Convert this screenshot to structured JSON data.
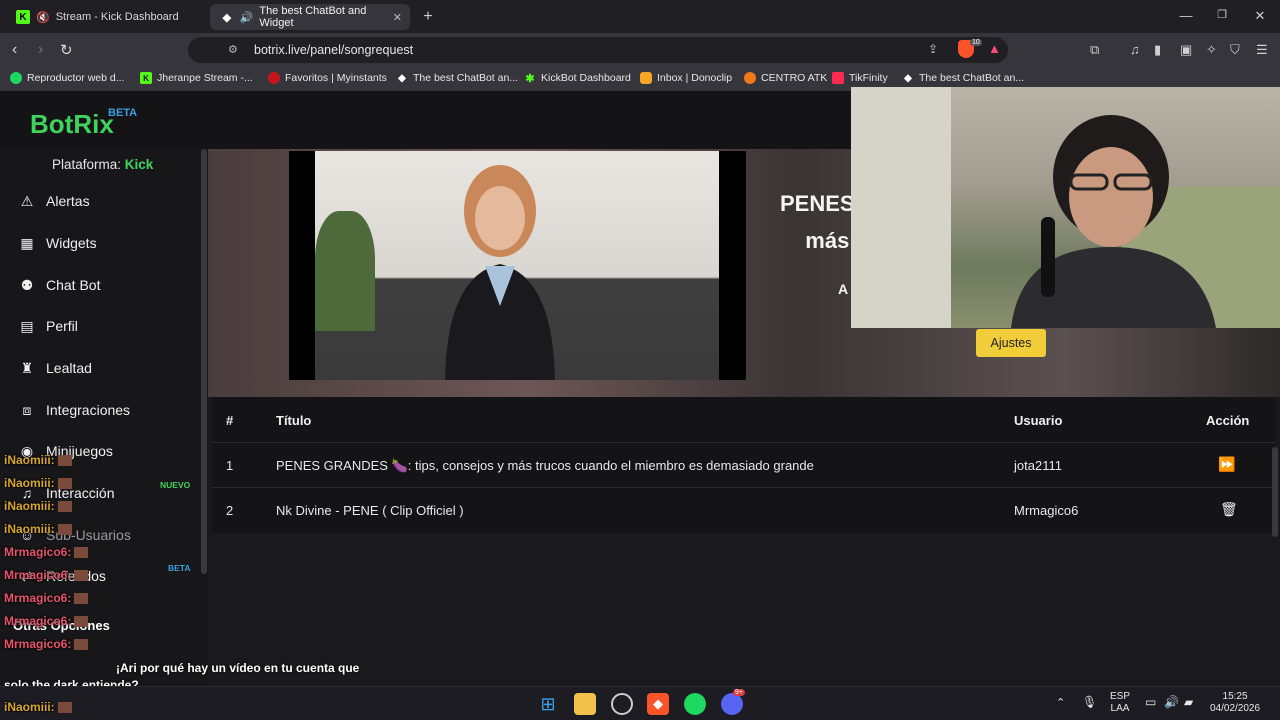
{
  "browser": {
    "tabs": [
      {
        "title": "Stream - Kick Dashboard",
        "active": false
      },
      {
        "title": "The best ChatBot and Widget",
        "active": true
      }
    ],
    "url": "botrix.live/panel/songrequest",
    "bookmarks": [
      "Reproductor web d...",
      "Jheranpe Stream -...",
      "Favoritos | Myinstants",
      "The best ChatBot an...",
      "KickBot Dashboard",
      "Inbox | Donoclip",
      "CENTRO ATK",
      "TikFinity",
      "The best ChatBot an..."
    ],
    "shield_count": "10"
  },
  "app": {
    "logo": "BotRix",
    "logo_badge": "BETA",
    "platform_label": "Plataforma:",
    "platform_value": "Kick",
    "nav": [
      {
        "label": "Alertas",
        "icon": "warning-icon"
      },
      {
        "label": "Widgets",
        "icon": "grid-icon"
      },
      {
        "label": "Chat Bot",
        "icon": "robot-icon"
      },
      {
        "label": "Perfil",
        "icon": "id-card-icon"
      },
      {
        "label": "Lealtad",
        "icon": "trophy-icon"
      },
      {
        "label": "Integraciones",
        "icon": "plug-icon"
      },
      {
        "label": "Minijuegos",
        "icon": "gamepad-icon"
      },
      {
        "label": "Interacción",
        "icon": "music-icon"
      },
      {
        "label": "Sub-Usuarios",
        "icon": "users-icon"
      },
      {
        "label": "Referidos",
        "icon": "share-icon"
      }
    ],
    "badge_nuevo": "NUEVO",
    "badge_beta": "BETA",
    "section_other": "Otras Opciones",
    "hero_title_line1": "PENES",
    "hero_title_line2": "más",
    "hero_title_partial": "A",
    "settings_button": "Ajustes",
    "table": {
      "headers": [
        "#",
        "Título",
        "Usuario",
        "Acción"
      ],
      "rows": [
        {
          "n": "1",
          "title": "PENES GRANDES 🍆: tips, consejos y más trucos cuando el miembro es demasiado grande",
          "user": "jota2111",
          "action": "skip"
        },
        {
          "n": "2",
          "title": "Nk Divine - PENE ( Clip Officiel )",
          "user": "Mrmagico6",
          "action": "delete"
        }
      ]
    }
  },
  "chat": {
    "lines": [
      {
        "user": "iNaomiii:",
        "color": "n"
      },
      {
        "user": "iNaomiii:",
        "color": "n"
      },
      {
        "user": "iNaomiii:",
        "color": "n"
      },
      {
        "user": "iNaomiii:",
        "color": "n"
      },
      {
        "user": "Mrmagico6:",
        "color": "m"
      },
      {
        "user": "Mrmagico6:",
        "color": "m"
      },
      {
        "user": "Mrmagico6:",
        "color": "m"
      },
      {
        "user": "Mrmagico6:",
        "color": "m"
      },
      {
        "user": "Mrmagico6:",
        "color": "m"
      }
    ],
    "message_line1": "¡Ari por qué hay un vídeo en tu cuenta que",
    "message_line2": "solo the dark entiende?",
    "last_user": "iNaomiii:"
  },
  "taskbar": {
    "lang_top": "ESP",
    "lang_bottom": "LAA",
    "time": "15:25",
    "date": "04/02/2026",
    "discord_badge": "9+"
  }
}
